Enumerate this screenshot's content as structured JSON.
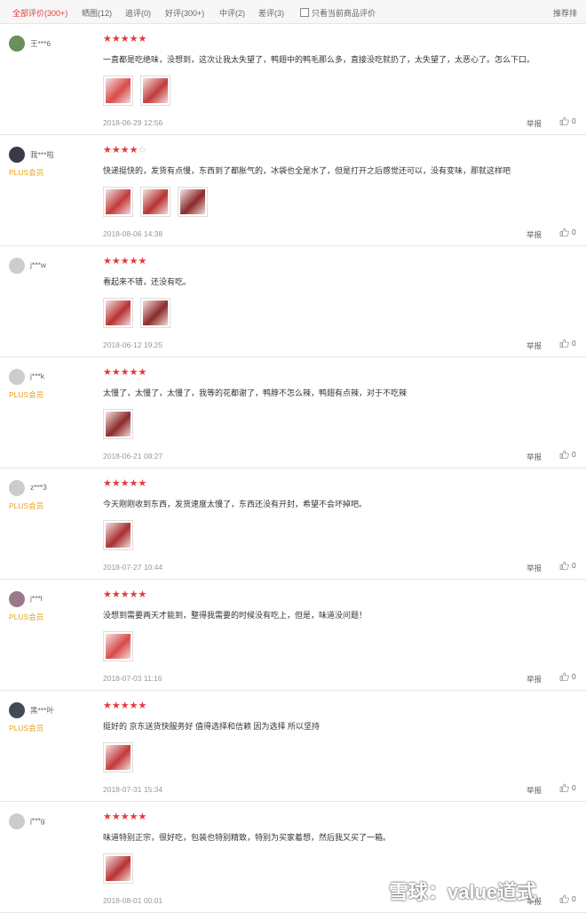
{
  "tabs": {
    "all": "全部评价(300+)",
    "photos": "晒图(12)",
    "followup": "追评(0)",
    "good": "好评(300+)",
    "medium": "中评(2)",
    "bad": "差评(3)",
    "only_current": "只看当前商品评价",
    "sort": "推荐排"
  },
  "reviews": [
    {
      "user": "王***6",
      "plus": "",
      "stars": 5,
      "text": "一直都是吃绝味，没想到，这次让我太失望了，鸭翅中的鸭毛那么多，直接没吃就扔了，太失望了，太恶心了。怎么下口。",
      "date": "2018-06-29 12:56",
      "report": "举报",
      "likes": "0",
      "thumbs": 2
    },
    {
      "user": "我***啦",
      "plus": "PLUS会员",
      "stars": 4,
      "text": "快递挺快的，发货有点慢，东西到了都胀气的，冰袋也全是水了，但是打开之后感觉还可以，没有变味，那就这样吧",
      "date": "2018-08-06 14:38",
      "report": "举报",
      "likes": "0",
      "thumbs": 3
    },
    {
      "user": "j***w",
      "plus": "",
      "stars": 5,
      "text": "看起来不错，还没有吃。",
      "date": "2018-06-12 19:25",
      "report": "举报",
      "likes": "0",
      "thumbs": 2
    },
    {
      "user": "j***k",
      "plus": "PLUS会员",
      "stars": 5,
      "text": "太慢了，太慢了，太慢了，我等的花都谢了，鸭脖不怎么辣，鸭翅有点辣，对于不吃辣",
      "date": "2018-06-21 08:27",
      "report": "举报",
      "likes": "0",
      "thumbs": 1
    },
    {
      "user": "z***3",
      "plus": "PLUS会员",
      "stars": 5,
      "text": "今天刚刚收到东西，发货速度太慢了，东西还没有开封，希望不会坏掉吧。",
      "date": "2018-07-27 10:44",
      "report": "举报",
      "likes": "0",
      "thumbs": 1
    },
    {
      "user": "j***l",
      "plus": "PLUS会员",
      "stars": 5,
      "text": "没想到需要两天才能到，整得我需要的时候没有吃上，但是，味道没问题！",
      "date": "2018-07-03 11:16",
      "report": "举报",
      "likes": "0",
      "thumbs": 1
    },
    {
      "user": "黑***叶",
      "plus": "PLUS会员",
      "stars": 5,
      "text": "挺好的 京东送货快服务好 值得选择和信赖 因为选择 所以坚持",
      "date": "2018-07-31 15:34",
      "report": "举报",
      "likes": "0",
      "thumbs": 1
    },
    {
      "user": "j***g",
      "plus": "",
      "stars": 5,
      "text": "味道特别正宗，很好吃，包装也特别精致，特别为买家着想，然后我又买了一箱。",
      "date": "2018-08-01 00:01",
      "report": "举报",
      "likes": "0",
      "thumbs": 1
    }
  ],
  "watermark": "雪球：value道式",
  "colors": {
    "accent": "#e4393c",
    "plus": "#e8a31d"
  }
}
